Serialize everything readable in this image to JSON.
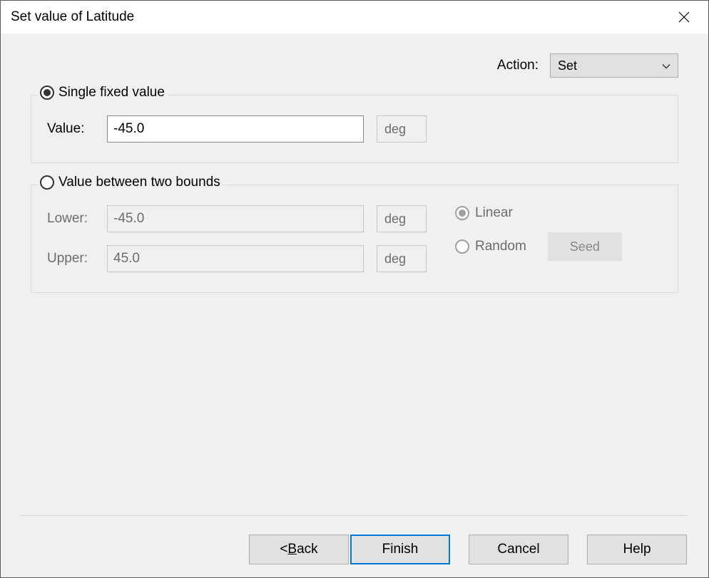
{
  "title": "Set value of Latitude",
  "action": {
    "label": "Action:",
    "selected": "Set"
  },
  "single": {
    "legend": "Single fixed value",
    "checked": true,
    "value_label": "Value:",
    "value": "-45.0",
    "unit": "deg"
  },
  "range": {
    "legend": "Value between two bounds",
    "checked": false,
    "lower_label": "Lower:",
    "lower": "-45.0",
    "upper_label": "Upper:",
    "upper": "45.0",
    "unit": "deg",
    "linear_label": "Linear",
    "random_label": "Random",
    "dist_selected": "Linear",
    "seed_label": "Seed"
  },
  "buttons": {
    "back_prefix": "< ",
    "back_mn": "B",
    "back_suffix": "ack",
    "finish": "Finish",
    "cancel": "Cancel",
    "help": "Help"
  }
}
